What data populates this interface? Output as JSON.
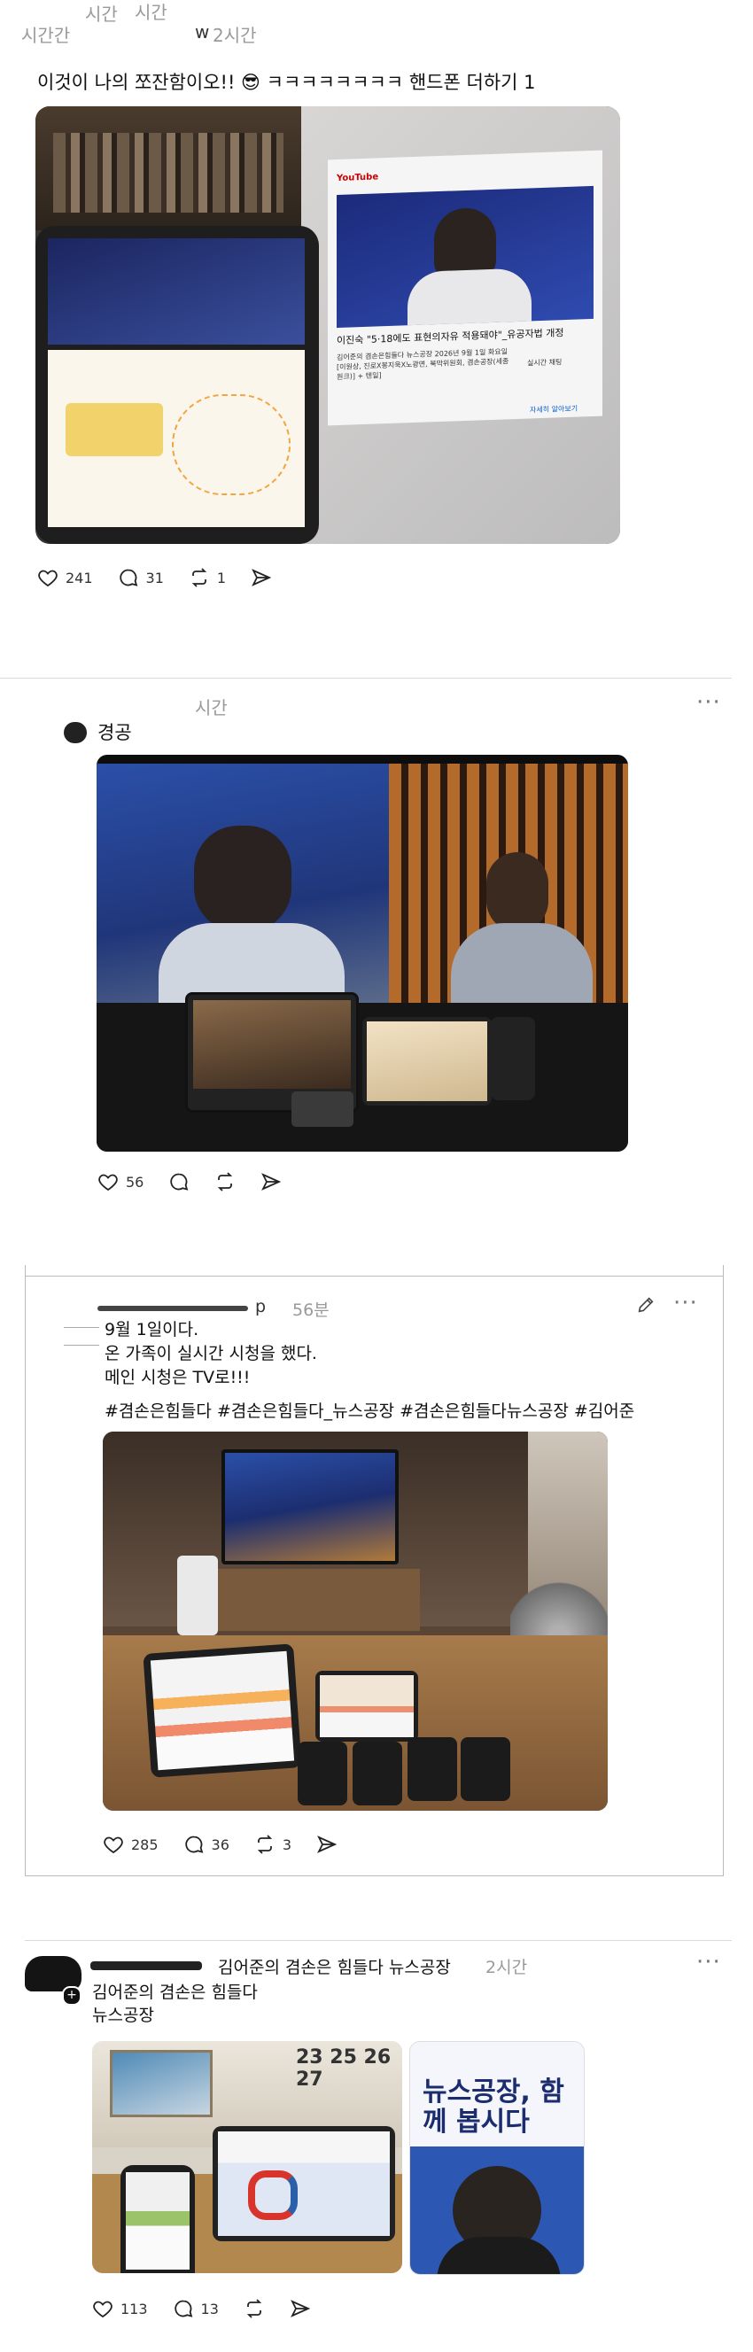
{
  "post1": {
    "time_fragments": [
      "시간",
      "시간",
      "시간간"
    ],
    "author_tail": "w",
    "time": "2시간",
    "text": "이것이 나의 쪼잔함이오!! 😎 ㅋㅋㅋㅋㅋㅋㅋㅋ 핸드폰 더하기 1",
    "photo": {
      "youtube_title": "이진숙 \"5·18에도 표현의자유 적용돼야\"_유공자법 개정",
      "channel": "YouTube",
      "desc": "김어준의 겸손은힘들다 뉴스공장 2026년 9월 1일 화요일 [이원상, 진로X봉지욱X노광면, 북막위원회, 겸손공장(세종원크)] + 텐일]",
      "side_label": "실시간 채팅",
      "link": "자세히 알아보기"
    },
    "stats": {
      "likes": "241",
      "comments": "31",
      "reposts": "1"
    }
  },
  "post2": {
    "time": "시간",
    "text": "경공",
    "stats": {
      "likes": "56"
    }
  },
  "post3": {
    "username_tail": "p",
    "time": "56분",
    "lines": [
      "9월 1일이다.",
      "온 가족이 실시간 시청을 했다.",
      "메인 시청은 TV로!!!"
    ],
    "hashtags": "#겸손은힘들다 #겸손은힘들다_뉴스공장 #겸손은힘들다뉴스공장 #김어준",
    "stats": {
      "likes": "285",
      "comments": "36",
      "reposts": "3"
    }
  },
  "post4": {
    "author": "김어준의 겸손은 힘들다 뉴스공장",
    "time": "2시간",
    "lines": [
      "김어준의 겸손은 힘들다",
      "뉴스공장"
    ],
    "poster_title": "뉴스공장, 함께 봅시다",
    "calendar": "23 25 26 27",
    "stats": {
      "likes": "113",
      "comments": "13"
    }
  },
  "colors": {
    "accent": "#d9342b",
    "meta": "#9a9a9a",
    "divider": "#d9d9d9"
  }
}
